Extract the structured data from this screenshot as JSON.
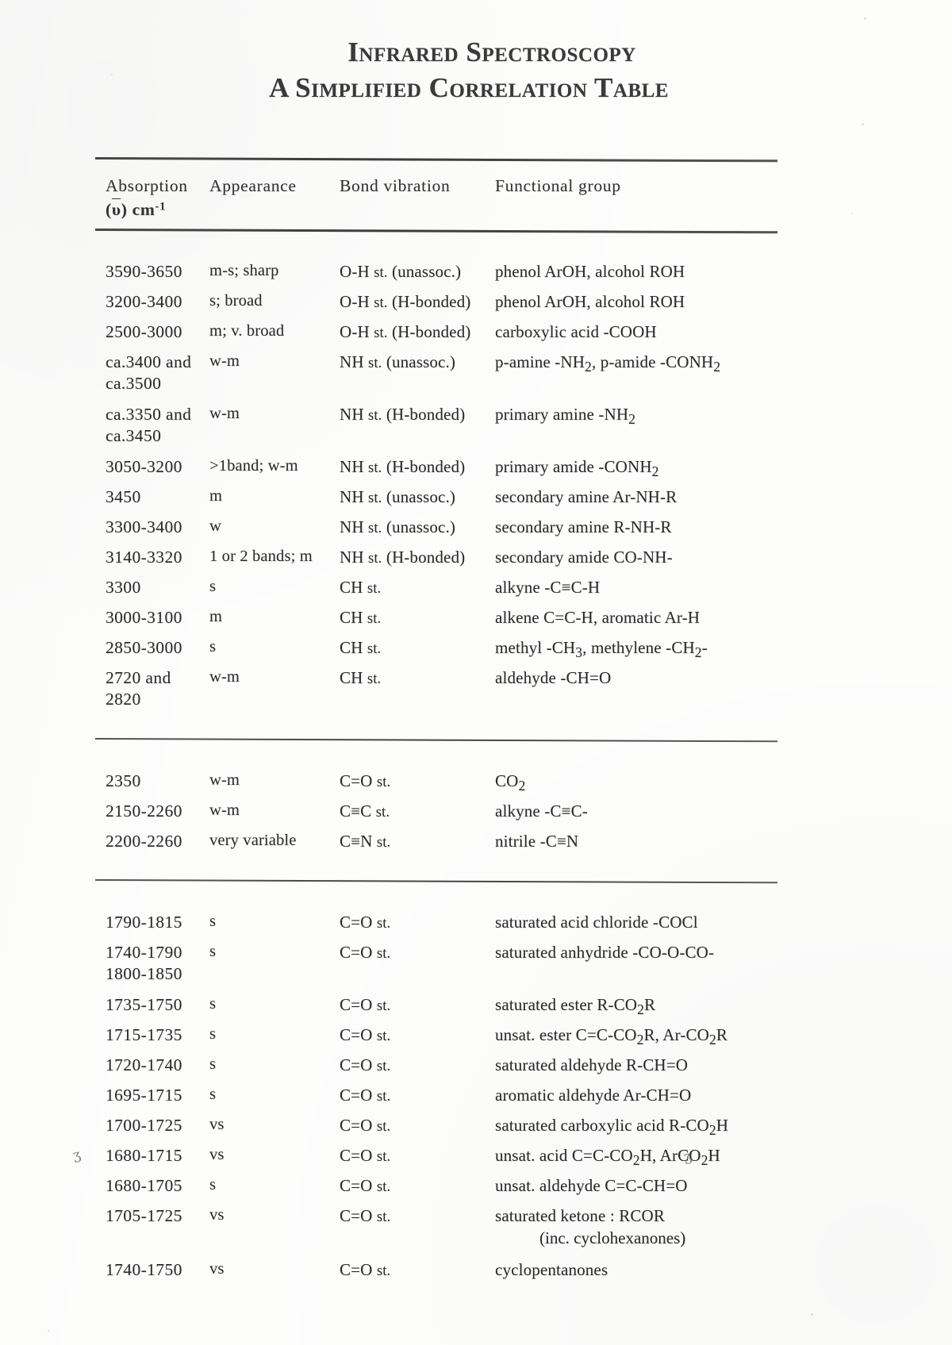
{
  "document": {
    "title_line_1": "Infrared Spectroscopy",
    "title_line_2": "A Simplified Correlation Table"
  },
  "table": {
    "headers": {
      "absorption": "Absorption",
      "absorption_units_prefix": "(",
      "absorption_units_symbol": "υ",
      "absorption_units_suffix": ") cm",
      "absorption_units_exponent": "-1",
      "appearance": "Appearance",
      "bond_vibration": "Bond vibration",
      "functional_group": "Functional group"
    },
    "blocks": [
      {
        "id": "block-oh-nh-ch",
        "rows": [
          {
            "absorption": "3590-3650",
            "appearance": "m-s; sharp",
            "bond_vibration": "O-H st. (unassoc.)",
            "functional_group": "phenol ArOH, alcohol ROH"
          },
          {
            "absorption": "3200-3400",
            "appearance": "s; broad",
            "bond_vibration": "O-H st. (H-bonded)",
            "functional_group": "phenol ArOH, alcohol ROH"
          },
          {
            "absorption": "2500-3000",
            "appearance": "m; v. broad",
            "bond_vibration": "O-H st. (H-bonded)",
            "functional_group": "carboxylic acid -COOH"
          },
          {
            "absorption": "ca.3400 and",
            "absorption_line2": "ca.3500",
            "appearance": "w-m",
            "bond_vibration": "NH st. (unassoc.)",
            "functional_group_html": "p-amine -NH<sub>2</sub>, p-amide -CONH<sub>2</sub>",
            "functional_group": "p-amine -NH2, p-amide -CONH2"
          },
          {
            "absorption": "ca.3350 and",
            "absorption_line2": "ca.3450",
            "appearance": "w-m",
            "bond_vibration": "NH st. (H-bonded)",
            "functional_group_html": "primary amine -NH<sub>2</sub>",
            "functional_group": "primary amine -NH2"
          },
          {
            "absorption": "3050-3200",
            "appearance": ">1band; w-m",
            "bond_vibration": "NH st. (H-bonded)",
            "functional_group_html": "primary amide -CONH<sub>2</sub>",
            "functional_group": "primary amide -CONH2"
          },
          {
            "absorption": "3450",
            "appearance": "m",
            "bond_vibration": "NH st. (unassoc.)",
            "functional_group": "secondary amine Ar-NH-R"
          },
          {
            "absorption": "3300-3400",
            "appearance": "w",
            "bond_vibration": "NH st. (unassoc.)",
            "functional_group": "secondary amine R-NH-R"
          },
          {
            "absorption": "3140-3320",
            "appearance": "1 or 2 bands; m",
            "bond_vibration": "NH st. (H-bonded)",
            "functional_group": "secondary amide CO-NH-"
          },
          {
            "absorption": "3300",
            "appearance": "s",
            "bond_vibration": "CH st.",
            "functional_group": "alkyne -C≡C-H"
          },
          {
            "absorption": "3000-3100",
            "appearance": "m",
            "bond_vibration": "CH st.",
            "functional_group": "alkene C=C-H, aromatic Ar-H"
          },
          {
            "absorption": "2850-3000",
            "appearance": "s",
            "bond_vibration": "CH st.",
            "functional_group_html": "methyl -CH<sub>3</sub>, methylene -CH<sub>2</sub>-",
            "functional_group": "methyl -CH3, methylene -CH2-"
          },
          {
            "absorption": "2720 and",
            "absorption_line2": "2820",
            "appearance": "w-m",
            "bond_vibration": "CH st.",
            "functional_group": "aldehyde -CH=O"
          }
        ]
      },
      {
        "id": "block-triple-bonds",
        "rows": [
          {
            "absorption": "2350",
            "appearance": "w-m",
            "bond_vibration": "C=O st.",
            "functional_group_html": "CO<sub>2</sub>",
            "functional_group": "CO2"
          },
          {
            "absorption": "2150-2260",
            "appearance": "w-m",
            "bond_vibration": "C≡C st.",
            "functional_group": "alkyne -C≡C-"
          },
          {
            "absorption": "2200-2260",
            "appearance": "very variable",
            "bond_vibration": "C≡N st.",
            "functional_group": "nitrile -C≡N"
          }
        ]
      },
      {
        "id": "block-carbonyl",
        "rows": [
          {
            "absorption": "1790-1815",
            "appearance": "s",
            "bond_vibration": "C=O st.",
            "functional_group": "saturated acid chloride -COCl"
          },
          {
            "absorption": "1740-1790",
            "absorption_line2": "1800-1850",
            "appearance": "s",
            "bond_vibration": "C=O st.",
            "functional_group": "saturated anhydride -CO-O-CO-"
          },
          {
            "absorption": "1735-1750",
            "appearance": "s",
            "bond_vibration": "C=O st.",
            "functional_group_html": "saturated ester  R-CO<sub>2</sub>R",
            "functional_group": "saturated ester  R-CO2R"
          },
          {
            "absorption": "1715-1735",
            "appearance": "s",
            "bond_vibration": "C=O st.",
            "functional_group_html": "unsat. ester  C=C-CO<sub>2</sub>R,  Ar-CO<sub>2</sub>R",
            "functional_group": "unsat. ester  C=C-CO2R,  Ar-CO2R"
          },
          {
            "absorption": "1720-1740",
            "appearance": "s",
            "bond_vibration": "C=O st.",
            "functional_group": "saturated aldehyde R-CH=O"
          },
          {
            "absorption": "1695-1715",
            "appearance": "s",
            "bond_vibration": "C=O st.",
            "functional_group": "aromatic aldehyde Ar-CH=O"
          },
          {
            "absorption": "1700-1725",
            "appearance": "vs",
            "bond_vibration": "C=O st.",
            "functional_group_html": "saturated carboxylic acid R-CO<sub>2</sub>H",
            "functional_group": "saturated carboxylic acid R-CO2H"
          },
          {
            "absorption": "1680-1715",
            "appearance": "vs",
            "bond_vibration": "C=O st.",
            "functional_group_html": "unsat. acid C=C-CO<sub>2</sub>H, ArCO<sub>2</sub>H",
            "functional_group": "unsat. acid C=C-CO2H, ArCO2H"
          },
          {
            "absorption": "1680-1705",
            "appearance": "s",
            "bond_vibration": "C=O st.",
            "functional_group": "unsat. aldehyde C=C-CH=O"
          },
          {
            "absorption": "1705-1725",
            "appearance": "vs",
            "bond_vibration": "C=O st.",
            "functional_group": "saturated ketone : RCOR",
            "functional_group_note": "(inc. cyclohexanones)",
            "marked": true
          },
          {
            "absorption": "1740-1750",
            "appearance": "vs",
            "bond_vibration": "C=O st.",
            "functional_group": "cyclopentanones"
          }
        ]
      }
    ]
  },
  "annotations": {
    "left_pencil_mark": "ʒ",
    "right_pencil_mark": "ʒ"
  }
}
